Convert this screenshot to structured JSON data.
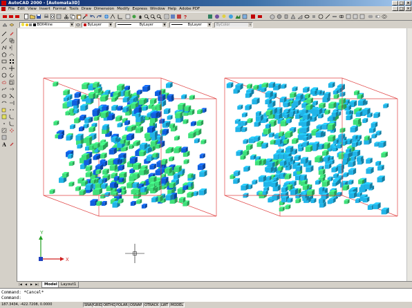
{
  "window": {
    "title": "AutoCAD 2000 - [Automata3D]"
  },
  "menu": [
    "File",
    "Edit",
    "View",
    "Insert",
    "Format",
    "Tools",
    "Draw",
    "Dimension",
    "Modify",
    "Express",
    "Window",
    "Help",
    "Adobe PDF"
  ],
  "properties": {
    "layer": "BOX4line",
    "color": "ByLayer",
    "linetype": "ByLayer",
    "lineweight": "ByLayer",
    "plotstyle": "ByColor"
  },
  "tabs": [
    "Model",
    "Layout1"
  ],
  "command": {
    "line1": "Command: *Cancel*",
    "line2": "Command:"
  },
  "status": {
    "coords": "187.3434, -422.7208, 0.0000",
    "toggles": [
      "SNAP",
      "GRID",
      "ORTHO",
      "POLAR",
      "OSNAP",
      "OTRACK",
      "LWT",
      "MODEL"
    ]
  },
  "ucs": {
    "x_label": "X",
    "y_label": "Y"
  },
  "colors": {
    "titlebar": "#0a246a",
    "canvas": "#ffffff",
    "box_edges": "#e04040",
    "voxel_green": "#3ee07a",
    "voxel_cyan": "#20b4e8",
    "voxel_blue": "#1060e0"
  }
}
